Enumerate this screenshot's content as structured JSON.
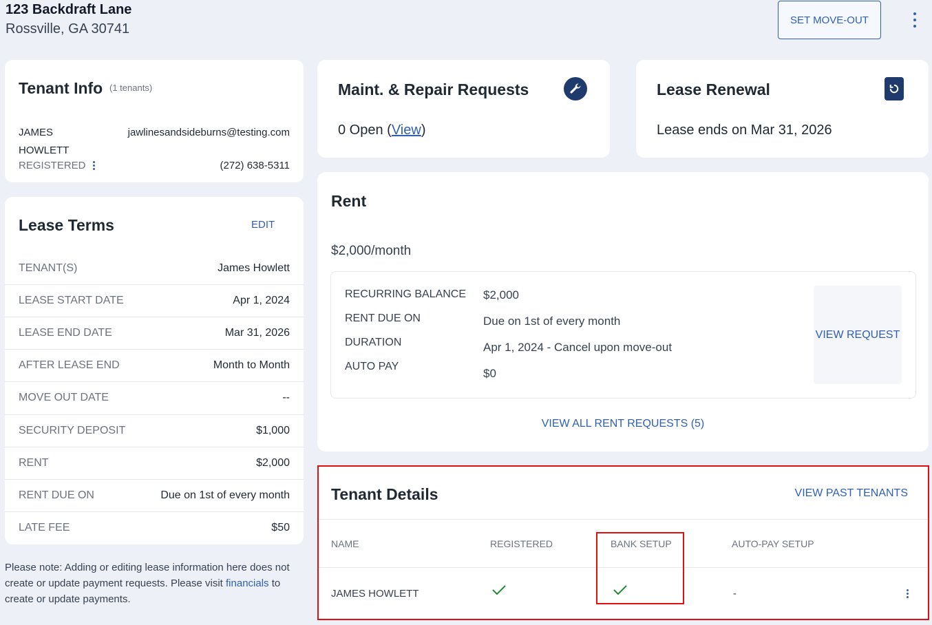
{
  "header": {
    "address_line1": "123 Backdraft Lane",
    "address_line2": "Rossville, GA 30741",
    "move_out_button": "SET MOVE-OUT",
    "menu_icon": "more-vertical-icon",
    "accent": "#2f5fb3"
  },
  "tenant_info": {
    "title": "Tenant Info",
    "count": "(1 tenants)",
    "name_line1": "JAMES",
    "name_line2": "HOWLETT",
    "email": "jawlinesandsideburns@testing.com",
    "status": "REGISTERED",
    "phone": "(272) 638-5311"
  },
  "lease_terms": {
    "title": "Lease Terms",
    "edit_label": "EDIT",
    "rows": [
      {
        "label": "TENANT(S)",
        "value": "James Howlett"
      },
      {
        "label": "LEASE START DATE",
        "value": "Apr 1, 2024"
      },
      {
        "label": "LEASE END DATE",
        "value": "Mar 31, 2026"
      },
      {
        "label": "AFTER LEASE END",
        "value": "Month to Month"
      },
      {
        "label": "MOVE OUT DATE",
        "value": "--"
      },
      {
        "label": "SECURITY DEPOSIT",
        "value": "$1,000"
      },
      {
        "label": "RENT",
        "value": "$2,000"
      },
      {
        "label": "RENT DUE ON",
        "value": "Due on 1st of every month"
      },
      {
        "label": "LATE FEE",
        "value": "$50"
      }
    ]
  },
  "note": {
    "before": "Please note: Adding or editing lease information here does not create or update payment requests. Please visit ",
    "link": "financials",
    "after": " to create or update payments."
  },
  "maint": {
    "title": "Maint. & Repair Requests",
    "open_text": "0 Open (",
    "view_link": "View",
    "close_paren": ")",
    "icon": "wrench-icon"
  },
  "renewal": {
    "title": "Lease Renewal",
    "text": "Lease ends on Mar 31, 2026",
    "icon": "renew-document-icon"
  },
  "rent": {
    "title": "Rent",
    "amount": "$2,000/month",
    "items": [
      {
        "label": "RECURRING BALANCE",
        "value": "$2,000"
      },
      {
        "label": "RENT DUE ON",
        "value": "Due on 1st of every month"
      },
      {
        "label": "DURATION",
        "value": "Apr 1, 2024 - Cancel upon move-out"
      },
      {
        "label": "AUTO PAY",
        "value": "$0"
      }
    ],
    "view_request": "VIEW REQUEST",
    "view_all": "VIEW ALL RENT REQUESTS (5)"
  },
  "tenant_details": {
    "title": "Tenant Details",
    "past_tenants": "VIEW PAST TENANTS",
    "columns": [
      "NAME",
      "REGISTERED",
      "BANK SETUP",
      "AUTO-PAY SETUP"
    ],
    "rows": [
      {
        "name": "JAMES HOWLETT",
        "registered": "check-icon",
        "bank_setup": "check-icon",
        "auto_pay": "-"
      }
    ],
    "highlight_color": "#e01010",
    "check_color": "#1f8a3a"
  }
}
